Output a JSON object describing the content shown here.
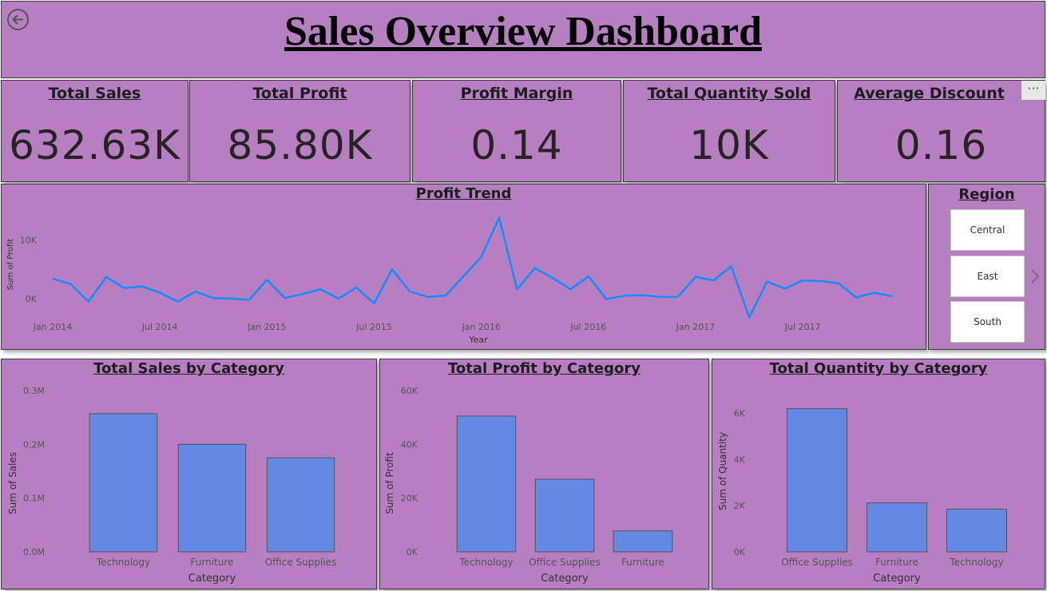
{
  "header": {
    "title": "Sales Overview Dashboard"
  },
  "kpis": [
    {
      "title": "Total Sales",
      "value": "632.63K"
    },
    {
      "title": "Total Profit",
      "value": "85.80K"
    },
    {
      "title": "Profit Margin",
      "value": "0.14"
    },
    {
      "title": "Total Quantity Sold",
      "value": "10K"
    },
    {
      "title": "Average Discount",
      "value": "0.16"
    }
  ],
  "more_options": {
    "label": "···"
  },
  "colors": {
    "panel_bg": "#b77fc2",
    "bar": "#6389e3",
    "line": "#118dff",
    "text_dark": "#252423"
  },
  "slicer": {
    "title": "Region",
    "items": [
      "Central",
      "East",
      "South"
    ]
  },
  "chart_data": [
    {
      "type": "line",
      "title": "Profit Trend",
      "xlabel": "Year",
      "ylabel": "Sum of Profit",
      "x_ticks": [
        "Jan 2014",
        "Jul 2014",
        "Jan 2015",
        "Jul 2015",
        "Jan 2016",
        "Jul 2016",
        "Jan 2017",
        "Jul 2017"
      ],
      "y_ticks": [
        "0K",
        "10K"
      ],
      "ylim": [
        -3000,
        14000
      ],
      "x": [
        "2014-01",
        "2014-02",
        "2014-03",
        "2014-04",
        "2014-05",
        "2014-06",
        "2014-07",
        "2014-08",
        "2014-09",
        "2014-10",
        "2014-11",
        "2014-12",
        "2015-01",
        "2015-02",
        "2015-03",
        "2015-04",
        "2015-05",
        "2015-06",
        "2015-07",
        "2015-08",
        "2015-09",
        "2015-10",
        "2015-11",
        "2015-12",
        "2016-01",
        "2016-02",
        "2016-03",
        "2016-04",
        "2016-05",
        "2016-06",
        "2016-07",
        "2016-08",
        "2016-09",
        "2016-10",
        "2016-11",
        "2016-12",
        "2017-01",
        "2017-02",
        "2017-03",
        "2017-04",
        "2017-05",
        "2017-06",
        "2017-07",
        "2017-08",
        "2017-09",
        "2017-10",
        "2017-11",
        "2017-12"
      ],
      "series": [
        {
          "values": [
            3400,
            2500,
            -500,
            3700,
            1800,
            2100,
            1000,
            -500,
            1200,
            100,
            0,
            -200,
            3200,
            100,
            800,
            1600,
            0,
            1900,
            -800,
            5000,
            1200,
            300,
            500,
            3800,
            7100,
            13800,
            1600,
            5200,
            3500,
            1600,
            3800,
            -100,
            500,
            600,
            300,
            300,
            3700,
            3100,
            5500,
            -3200,
            2900,
            1700,
            3100,
            3000,
            2600,
            200,
            1000,
            400
          ]
        }
      ],
      "grid": false
    },
    {
      "type": "bar",
      "title": "Total Sales by Category",
      "xlabel": "Category",
      "ylabel": "Sum of Sales",
      "categories": [
        "Technology",
        "Furniture",
        "Office Supplies"
      ],
      "values": [
        257000,
        200000,
        175000
      ],
      "y_ticks": [
        "0.0M",
        "0.1M",
        "0.2M",
        "0.3M"
      ],
      "ylim": [
        0,
        300000
      ]
    },
    {
      "type": "bar",
      "title": "Total Profit by Category",
      "xlabel": "Category",
      "ylabel": "Sum of Profit",
      "categories": [
        "Technology",
        "Office Supplies",
        "Furniture"
      ],
      "values": [
        50500,
        27000,
        7800
      ],
      "y_ticks": [
        "0K",
        "20K",
        "40K",
        "60K"
      ],
      "ylim": [
        0,
        60000
      ]
    },
    {
      "type": "bar",
      "title": "Total Quantity by Category",
      "xlabel": "Category",
      "ylabel": "Sum of Quantity",
      "categories": [
        "Office Supplies",
        "Furniture",
        "Technology"
      ],
      "values": [
        6200,
        2120,
        1850
      ],
      "y_ticks": [
        "0K",
        "2K",
        "4K",
        "6K"
      ],
      "ylim": [
        0,
        6500
      ]
    }
  ]
}
